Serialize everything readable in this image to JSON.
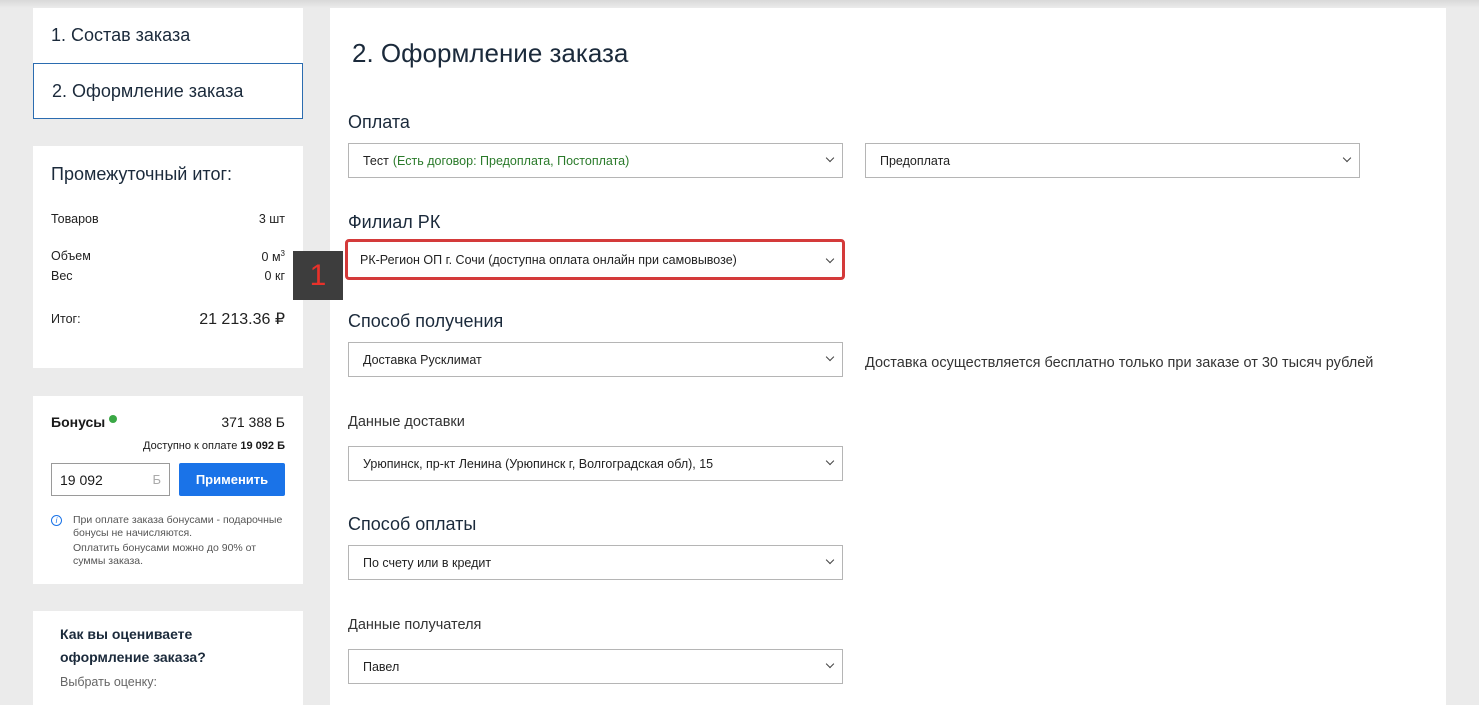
{
  "steps": [
    {
      "label": "1. Состав заказа"
    },
    {
      "label": "2. Оформление заказа"
    }
  ],
  "summary": {
    "title": "Промежуточный итог:",
    "rows": {
      "items": {
        "label": "Товаров",
        "value": "3 шт"
      },
      "volume": {
        "label": "Объем",
        "value": "0 м",
        "unit_sup": "3"
      },
      "weight": {
        "label": "Вес",
        "value": "0 кг"
      },
      "total": {
        "label": "Итог:",
        "value": "21 213.36 ₽"
      }
    }
  },
  "bonus": {
    "label": "Бонусы",
    "balance": "371 388 Б",
    "available_prefix": "Доступно к оплате",
    "available_value": "19 092 Б",
    "input_value": "19 092",
    "input_unit": "Б",
    "apply_label": "Применить",
    "info_icon": "i",
    "note1": "При оплате заказа бонусами - подарочные бонусы не начисляются.",
    "note2": "Оплатить бонусами можно до 90% от суммы заказа."
  },
  "rating": {
    "question": "Как вы оцениваете оформление заказа?",
    "sub": "Выбрать оценку:"
  },
  "main": {
    "title": "2. Оформление заказа",
    "payment": {
      "heading": "Оплата",
      "select1_main": "Тест",
      "select1_note": "(Есть договор: Предоплата, Постоплата)",
      "select2": "Предоплата"
    },
    "branch": {
      "heading": "Филиал РК",
      "value": "РК-Регион ОП г. Сочи (доступна оплата онлайн при самовывозе)",
      "marker": "1"
    },
    "receive": {
      "heading": "Способ получения",
      "value": "Доставка Русклимат",
      "note": "Доставка осуществляется бесплатно только при заказе от 30 тысяч рублей"
    },
    "delivery_data": {
      "heading": "Данные доставки",
      "value": "Урюпинск, пр-кт Ленина (Урюпинск г, Волгоградская обл), 15"
    },
    "pay_method": {
      "heading": "Способ оплаты",
      "value": "По счету или в кредит"
    },
    "recipient": {
      "heading": "Данные получателя",
      "value": "Павел"
    }
  },
  "colors": {
    "accent": "#1a73e8",
    "highlight": "#d43a3a",
    "bonus_green": "#3aa845"
  }
}
